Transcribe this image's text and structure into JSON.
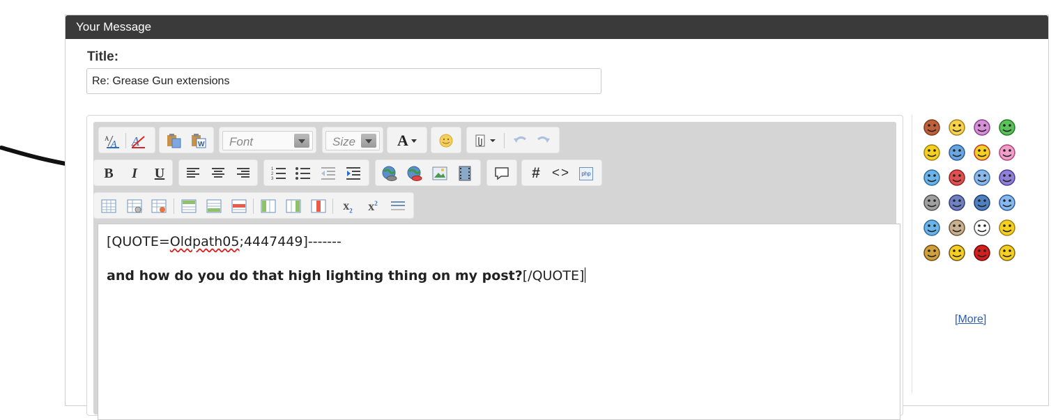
{
  "panel": {
    "header_title": "Your Message"
  },
  "title_field": {
    "label": "Title:",
    "value": "Re: Grease Gun extensions"
  },
  "toolbar": {
    "font_label": "Font",
    "size_label": "Size",
    "text_color_glyph": "A",
    "bold_glyph": "B",
    "italic_glyph": "I",
    "underline_glyph": "U",
    "hash_glyph": "#",
    "code_glyph": "<>",
    "php_glyph": "php",
    "subscript_glyph": "x",
    "subscript_sub": "2",
    "superscript_glyph": "x",
    "superscript_sup": "2"
  },
  "editor": {
    "line1_prefix": "[QUOTE=",
    "line1_user": "Oldpath05",
    "line1_suffix": ";4447449]-------",
    "line2_bold": "and how do you do that high lighting thing on my post?",
    "line2_tail": "[/QUOTE]"
  },
  "smilies": {
    "more_label": "[More]",
    "items": [
      "hi-icon",
      "smile-icon",
      "love-icon",
      "grin-icon",
      "laugh-icon",
      "cool-icon",
      "tongue-icon",
      "wink-tongue-icon",
      "blue-smile-icon",
      "mad-icon",
      "confused-icon",
      "purple-frown-icon",
      "grey-eek-icon",
      "rolleyes-icon",
      "blue-grin-icon",
      "shocked-icon",
      "blue-wink-icon",
      "199-icon",
      "thought-icon",
      "thumbs-icon",
      "hand-icon",
      "dance-icon",
      "heart-icon",
      "dots-icon"
    ]
  },
  "colors": {
    "header_bg": "#3a3a3a",
    "link": "#2a5db0",
    "accent": "#2e6cc2"
  }
}
